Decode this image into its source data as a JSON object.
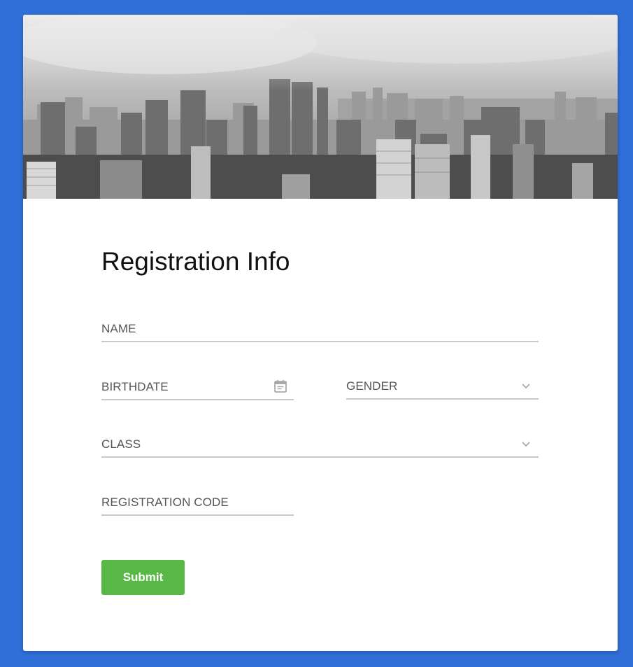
{
  "colors": {
    "page_background": "#2f6fd7",
    "card_background": "#ffffff",
    "submit_background": "#57b846",
    "field_underline": "#c9c9c9",
    "label_text": "#555555"
  },
  "hero": {
    "icon": "city-skyline-photo"
  },
  "form": {
    "title": "Registration Info",
    "fields": {
      "name": {
        "label": "NAME"
      },
      "birthdate": {
        "label": "BIRTHDATE",
        "icon": "calendar-icon"
      },
      "gender": {
        "label": "GENDER",
        "icon": "chevron-down-icon"
      },
      "class": {
        "label": "CLASS",
        "icon": "chevron-down-icon"
      },
      "registration_code": {
        "label": "REGISTRATION CODE"
      }
    },
    "submit_label": "Submit"
  }
}
